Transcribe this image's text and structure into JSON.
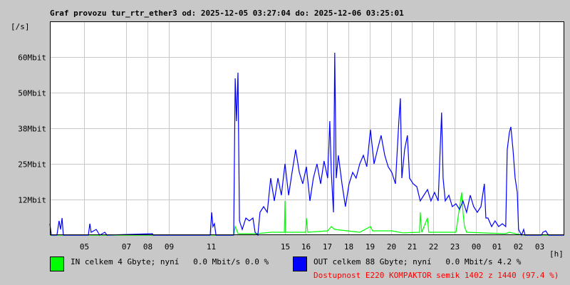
{
  "chart_data": {
    "type": "line",
    "title": "Graf provozu tur_rtr_ether3 od: 2025-12-05 03:27:04 do: 2025-12-06 03:25:01",
    "ylabel": "[/s]",
    "xlabel": "[h]",
    "ylim": [
      0,
      75
    ],
    "xlim_hours_from_start": [
      0,
      24.07
    ],
    "grid": true,
    "y_ticks": [
      {
        "value": 12.5,
        "label": "12Mbit"
      },
      {
        "value": 25,
        "label": "25Mbit"
      },
      {
        "value": 37.5,
        "label": "38Mbit"
      },
      {
        "value": 50,
        "label": "50Mbit"
      },
      {
        "value": 62.5,
        "label": "60Mbit"
      }
    ],
    "x_ticks": [
      {
        "h": 1.6,
        "label": "05"
      },
      {
        "h": 3.57,
        "label": "07"
      },
      {
        "h": 4.57,
        "label": "08"
      },
      {
        "h": 5.57,
        "label": "09"
      },
      {
        "h": 7.53,
        "label": "11"
      },
      {
        "h": 11,
        "label": "15"
      },
      {
        "h": 11.97,
        "label": "16"
      },
      {
        "h": 12.97,
        "label": "17"
      },
      {
        "h": 13.97,
        "label": "18"
      },
      {
        "h": 14.97,
        "label": "19"
      },
      {
        "h": 15.97,
        "label": "20"
      },
      {
        "h": 16.93,
        "label": "21"
      },
      {
        "h": 17.93,
        "label": "22"
      },
      {
        "h": 18.93,
        "label": "23"
      },
      {
        "h": 19.93,
        "label": "00"
      },
      {
        "h": 20.9,
        "label": "01"
      },
      {
        "h": 21.9,
        "label": "02"
      },
      {
        "h": 22.9,
        "label": "03"
      }
    ],
    "series": [
      {
        "name": "IN",
        "color": "#00ff00",
        "points": [
          [
            0,
            0
          ],
          [
            8.6,
            0
          ],
          [
            8.67,
            3
          ],
          [
            8.73,
            2
          ],
          [
            8.8,
            0.5
          ],
          [
            9.67,
            0.5
          ],
          [
            10.33,
            1
          ],
          [
            10.97,
            1
          ],
          [
            11,
            12
          ],
          [
            11.03,
            1
          ],
          [
            11.97,
            1
          ],
          [
            12,
            6
          ],
          [
            12.07,
            1
          ],
          [
            13,
            1.5
          ],
          [
            13.17,
            3
          ],
          [
            13.33,
            2
          ],
          [
            14.5,
            1
          ],
          [
            15,
            3
          ],
          [
            15.1,
            1.5
          ],
          [
            16,
            1.5
          ],
          [
            16.5,
            0.8
          ],
          [
            17.3,
            1
          ],
          [
            17.33,
            8
          ],
          [
            17.4,
            1
          ],
          [
            17.67,
            6
          ],
          [
            17.73,
            1
          ],
          [
            19,
            1
          ],
          [
            19.27,
            15
          ],
          [
            19.33,
            8
          ],
          [
            19.4,
            3
          ],
          [
            19.5,
            1
          ],
          [
            21.3,
            0.5
          ],
          [
            21.5,
            1
          ],
          [
            21.9,
            0.3
          ],
          [
            22.2,
            0
          ],
          [
            24.07,
            0
          ]
        ]
      },
      {
        "name": "OUT",
        "color": "#0000ff",
        "points": [
          [
            0,
            4
          ],
          [
            0.07,
            0
          ],
          [
            0.33,
            0
          ],
          [
            0.43,
            5
          ],
          [
            0.5,
            2
          ],
          [
            0.57,
            6
          ],
          [
            0.63,
            0
          ],
          [
            1.8,
            0
          ],
          [
            1.87,
            4
          ],
          [
            1.93,
            1
          ],
          [
            2.17,
            2
          ],
          [
            2.33,
            0
          ],
          [
            2.57,
            1
          ],
          [
            2.67,
            0
          ],
          [
            4.8,
            0.5
          ],
          [
            4.83,
            0
          ],
          [
            7.5,
            0
          ],
          [
            7.57,
            8
          ],
          [
            7.63,
            3
          ],
          [
            7.7,
            4
          ],
          [
            7.77,
            0
          ],
          [
            8.6,
            0
          ],
          [
            8.67,
            55
          ],
          [
            8.73,
            40
          ],
          [
            8.8,
            57
          ],
          [
            8.87,
            5
          ],
          [
            9,
            2
          ],
          [
            9.17,
            6
          ],
          [
            9.33,
            5
          ],
          [
            9.5,
            6
          ],
          [
            9.6,
            1
          ],
          [
            9.73,
            0
          ],
          [
            9.83,
            8
          ],
          [
            10,
            10
          ],
          [
            10.17,
            8
          ],
          [
            10.33,
            20
          ],
          [
            10.5,
            12
          ],
          [
            10.67,
            20
          ],
          [
            10.83,
            14
          ],
          [
            11,
            25
          ],
          [
            11.17,
            14
          ],
          [
            11.33,
            22
          ],
          [
            11.5,
            30
          ],
          [
            11.67,
            22
          ],
          [
            11.83,
            18
          ],
          [
            12,
            24
          ],
          [
            12.17,
            12
          ],
          [
            12.33,
            20
          ],
          [
            12.5,
            25
          ],
          [
            12.67,
            18
          ],
          [
            12.83,
            26
          ],
          [
            13,
            20
          ],
          [
            13.1,
            40
          ],
          [
            13.17,
            22
          ],
          [
            13.27,
            8
          ],
          [
            13.33,
            64
          ],
          [
            13.4,
            20
          ],
          [
            13.5,
            28
          ],
          [
            13.67,
            18
          ],
          [
            13.83,
            10
          ],
          [
            14,
            18
          ],
          [
            14.17,
            22
          ],
          [
            14.33,
            20
          ],
          [
            14.5,
            25
          ],
          [
            14.67,
            28
          ],
          [
            14.83,
            24
          ],
          [
            15,
            37
          ],
          [
            15.17,
            25
          ],
          [
            15.33,
            30
          ],
          [
            15.5,
            35
          ],
          [
            15.67,
            28
          ],
          [
            15.83,
            24
          ],
          [
            16,
            22
          ],
          [
            16.17,
            18
          ],
          [
            16.33,
            40
          ],
          [
            16.4,
            48
          ],
          [
            16.47,
            20
          ],
          [
            16.6,
            30
          ],
          [
            16.73,
            35
          ],
          [
            16.83,
            20
          ],
          [
            17,
            18
          ],
          [
            17.17,
            17
          ],
          [
            17.33,
            12
          ],
          [
            17.5,
            14
          ],
          [
            17.67,
            16
          ],
          [
            17.83,
            12
          ],
          [
            18,
            15
          ],
          [
            18.17,
            12
          ],
          [
            18.33,
            43
          ],
          [
            18.4,
            20
          ],
          [
            18.5,
            12
          ],
          [
            18.67,
            14
          ],
          [
            18.83,
            10
          ],
          [
            19,
            11
          ],
          [
            19.17,
            9
          ],
          [
            19.33,
            12
          ],
          [
            19.5,
            8
          ],
          [
            19.67,
            14
          ],
          [
            19.83,
            10
          ],
          [
            20,
            8
          ],
          [
            20.17,
            10
          ],
          [
            20.33,
            18
          ],
          [
            20.4,
            6
          ],
          [
            20.5,
            6
          ],
          [
            20.67,
            3
          ],
          [
            20.83,
            5
          ],
          [
            21,
            3
          ],
          [
            21.17,
            4
          ],
          [
            21.33,
            3
          ],
          [
            21.4,
            30
          ],
          [
            21.5,
            36
          ],
          [
            21.57,
            38
          ],
          [
            21.67,
            30
          ],
          [
            21.77,
            20
          ],
          [
            21.87,
            15
          ],
          [
            21.93,
            2
          ],
          [
            22.07,
            0
          ],
          [
            22.17,
            2
          ],
          [
            22.23,
            0
          ],
          [
            23,
            0
          ],
          [
            23.07,
            1
          ],
          [
            23.2,
            1.5
          ],
          [
            23.33,
            0
          ],
          [
            24.07,
            0
          ]
        ]
      }
    ]
  },
  "legend": {
    "in_text": "IN celkem 4 Gbyte; nyní   0.0 Mbit/s 0.0 %",
    "out_text": "OUT celkem 88 Gbyte; nyní   0.0 Mbit/s 4.2 %",
    "availability": "Dostupnost E220 KOMPAKTOR semik 1402 z 1440 (97.4 %)"
  }
}
